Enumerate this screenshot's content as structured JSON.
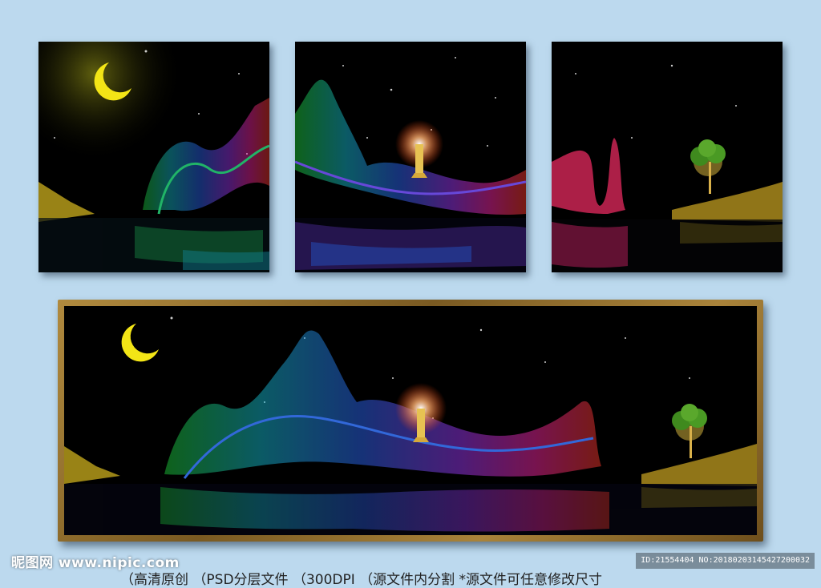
{
  "watermark": {
    "site": "昵图网 www.nipic.com",
    "id_line": "ID:21554404 NO:20180203145427200032"
  },
  "caption": "（高清原创    （PSD分层文件    （300DPI    （源文件内分割    *源文件可任意修改尺寸"
}
